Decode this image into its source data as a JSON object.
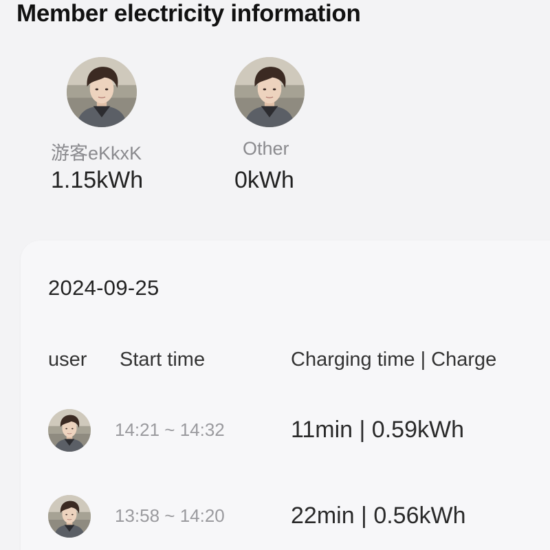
{
  "header": {
    "title": "Member electricity information"
  },
  "members": [
    {
      "name": "游客eKkxK",
      "energy": "1.15kWh"
    },
    {
      "name": "Other",
      "energy": "0kWh"
    }
  ],
  "records": {
    "date": "2024-09-25",
    "columns": {
      "user": "user",
      "start": "Start time",
      "charge": "Charging time | Charge"
    },
    "rows": [
      {
        "time_range": "14:21 ~ 14:32",
        "charge": "11min | 0.59kWh"
      },
      {
        "time_range": "13:58 ~ 14:20",
        "charge": "22min | 0.56kWh"
      }
    ]
  },
  "icons": {
    "avatar": "user-avatar-icon"
  },
  "colors": {
    "background": "#f3f3f5",
    "card": "#f7f7f9",
    "muted_text": "#8a8a8e"
  }
}
